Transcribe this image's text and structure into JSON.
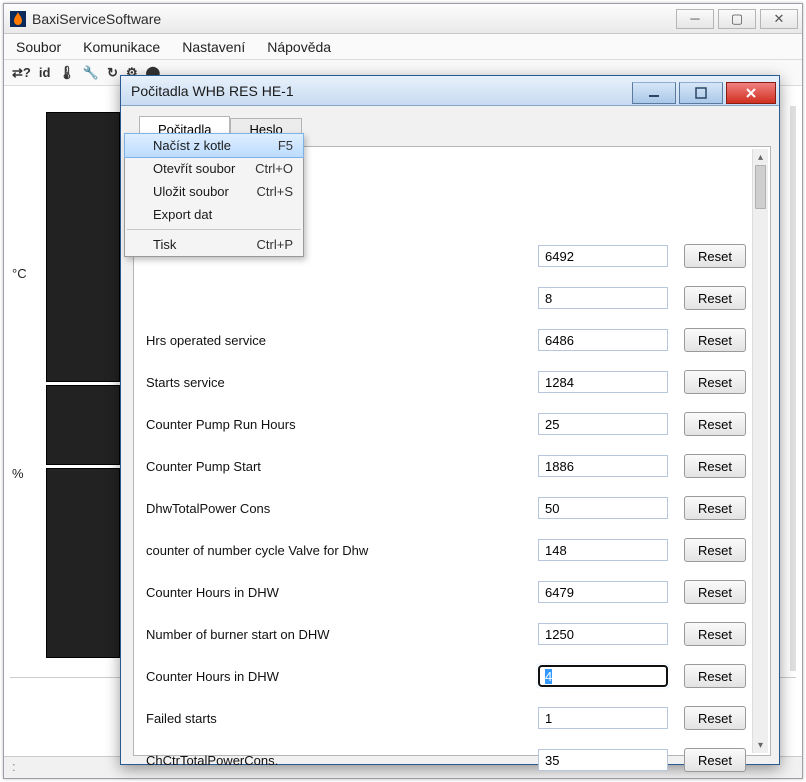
{
  "main": {
    "title": "BaxiServiceSoftware",
    "menus": [
      "Soubor",
      "Komunikace",
      "Nastavení",
      "Nápověda"
    ],
    "toolbar": [
      "⇄?",
      "id",
      "🌡",
      "🔧",
      "↻",
      "⚙",
      "⬤"
    ],
    "leftAxis": {
      "c": "°C",
      "p": "%"
    }
  },
  "dialog": {
    "title": "Počitadla  WHB RES HE-1",
    "tabs": [
      "Počitadla",
      "Heslo"
    ],
    "activeTab": 0,
    "menu": {
      "items": [
        {
          "label": "Načíst z kotle",
          "accel": "F5",
          "highlight": true
        },
        {
          "label": "Otevřít soubor",
          "accel": "Ctrl+O"
        },
        {
          "label": "Uložit soubor",
          "accel": "Ctrl+S"
        },
        {
          "label": "Export dat",
          "accel": ""
        }
      ],
      "sepAfter": 3,
      "tail": [
        {
          "label": "Tisk",
          "accel": "Ctrl+P"
        }
      ]
    },
    "resetLabel": "Reset",
    "rows": [
      {
        "label": "",
        "value": "6492"
      },
      {
        "label": "",
        "value": "8"
      },
      {
        "label": "Hrs operated service",
        "value": "6486"
      },
      {
        "label": "Starts service",
        "value": "1284"
      },
      {
        "label": "Counter Pump Run Hours",
        "value": "25"
      },
      {
        "label": "Counter Pump Start",
        "value": "1886"
      },
      {
        "label": "DhwTotalPower Cons",
        "value": "50"
      },
      {
        "label": "counter of number cycle Valve for Dhw",
        "value": "148"
      },
      {
        "label": "Counter Hours in DHW",
        "value": "6479"
      },
      {
        "label": "Number of burner start on DHW",
        "value": "1250"
      },
      {
        "label": "Counter Hours in DHW",
        "value": "4",
        "focused": true
      },
      {
        "label": "Failed starts",
        "value": "1"
      },
      {
        "label": "ChCtrTotalPowerCons.",
        "value": "35"
      }
    ]
  }
}
